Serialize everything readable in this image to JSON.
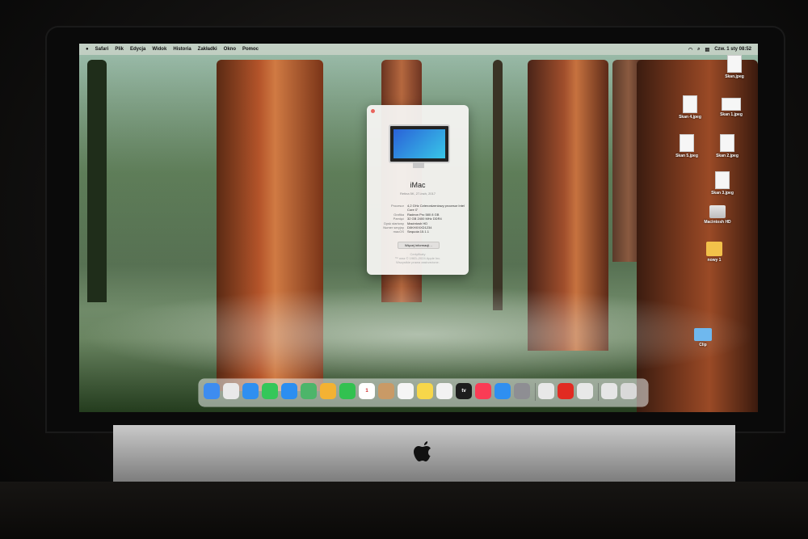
{
  "menubar": {
    "apple": "",
    "items": [
      "Safari",
      "Plik",
      "Edycja",
      "Widok",
      "Historia",
      "Zakładki",
      "Okno",
      "Pomoc"
    ],
    "clock": "Czw. 1 sty  08:52"
  },
  "about": {
    "title": "iMac",
    "subtitle": "Retina 5K, 27-inch, 2017",
    "specs": [
      {
        "k": "Procesor",
        "v": "4,2 GHz Czterordzeniowy procesor Intel Core i7"
      },
      {
        "k": "Grafika",
        "v": "Radeon Pro 580 8 GB"
      },
      {
        "k": "Pamięć",
        "v": "32 GB 2400 MHz DDR4"
      },
      {
        "k": "Dysk startowy",
        "v": "Macintosh HD"
      },
      {
        "k": "Numer seryjny",
        "v": "D0KHXXXD1234"
      },
      {
        "k": "macOS",
        "v": "Sequoia 15.1.1"
      }
    ],
    "more_button": "Więcej informacji…",
    "footer_1": "Certyfikaty",
    "footer_2": "™ oraz © 1983–2024 Apple Inc.",
    "footer_3": "Wszystkie prawa zastrzeżone."
  },
  "desktop_icons": [
    {
      "name": "Skan.jpeg",
      "kind": "doc"
    },
    {
      "name": "Skan 4.jpeg",
      "kind": "doc"
    },
    {
      "name": "Skan 1.jpeg",
      "kind": "doc-land"
    },
    {
      "name": "Skan 5.jpeg",
      "kind": "doc"
    },
    {
      "name": "Skan 2.jpeg",
      "kind": "doc"
    },
    {
      "name": "Skan 3.jpeg",
      "kind": "doc"
    },
    {
      "name": "Macintosh HD",
      "kind": "drive"
    },
    {
      "name": "nowy 1",
      "kind": "folder"
    },
    {
      "name": "Clip",
      "kind": "folder-blue"
    }
  ],
  "dock": {
    "apps": [
      {
        "name": "finder-icon",
        "label": "",
        "color": "#3d8cf0"
      },
      {
        "name": "launchpad-icon",
        "label": "",
        "color": "#e9e9e9"
      },
      {
        "name": "safari-icon",
        "label": "",
        "color": "#2f8ff0"
      },
      {
        "name": "messages-icon",
        "label": "",
        "color": "#34c759"
      },
      {
        "name": "mail-icon",
        "label": "",
        "color": "#2c8ef0"
      },
      {
        "name": "maps-icon",
        "label": "",
        "color": "#4db56a"
      },
      {
        "name": "photos-icon",
        "label": "",
        "color": "#f3b233"
      },
      {
        "name": "facetime-icon",
        "label": "",
        "color": "#32c150"
      },
      {
        "name": "calendar-icon",
        "label": "1",
        "color": "#ffffff"
      },
      {
        "name": "contacts-icon",
        "label": "",
        "color": "#c99a66"
      },
      {
        "name": "reminders-icon",
        "label": "",
        "color": "#f5f5f5"
      },
      {
        "name": "notes-icon",
        "label": "",
        "color": "#f7d74a"
      },
      {
        "name": "freeform-icon",
        "label": "",
        "color": "#f2f2f2"
      },
      {
        "name": "tv-icon",
        "label": "tv",
        "color": "#1d1d1d"
      },
      {
        "name": "music-icon",
        "label": "",
        "color": "#fa3c55"
      },
      {
        "name": "app-store-icon",
        "label": "",
        "color": "#2f8ff0"
      },
      {
        "name": "system-settings-icon",
        "label": "",
        "color": "#8e8e93"
      },
      {
        "name": "preview-icon",
        "label": "",
        "color": "#e8e8e8"
      },
      {
        "name": "acrobat-icon",
        "label": "",
        "color": "#e12b22"
      },
      {
        "name": "scanner-icon",
        "label": "",
        "color": "#e8e8e8"
      },
      {
        "name": "downloads-icon",
        "label": "",
        "color": "#e6e6e6"
      },
      {
        "name": "trash-icon",
        "label": "",
        "color": "#d9d9d9"
      }
    ]
  }
}
